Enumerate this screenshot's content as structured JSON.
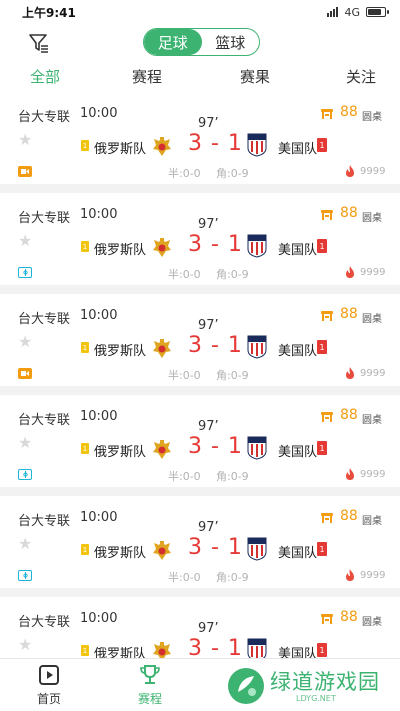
{
  "status_bar": {
    "time": "上午9:41",
    "network": "4G"
  },
  "sport_toggle": {
    "options": [
      "足球",
      "篮球"
    ],
    "selected": "足球"
  },
  "tabs": [
    "全部",
    "赛程",
    "赛果",
    "关注"
  ],
  "active_tab": "全部",
  "matches": [
    {
      "league": "台大专联",
      "time": "10:00",
      "minute": "97’",
      "home": "俄罗斯队",
      "home_yellow": "1",
      "score": "3 - 1",
      "away": "美国队",
      "away_red": "1",
      "half": "半:0-0",
      "corners": "角:0-9",
      "odds": "88",
      "table_label": "圆桌",
      "heat": "9999",
      "stream": "video"
    },
    {
      "league": "台大专联",
      "time": "10:00",
      "minute": "97’",
      "home": "俄罗斯队",
      "home_yellow": "1",
      "score": "3 - 1",
      "away": "美国队",
      "away_red": "1",
      "half": "半:0-0",
      "corners": "角:0-9",
      "odds": "88",
      "table_label": "圆桌",
      "heat": "9999",
      "stream": "animation"
    },
    {
      "league": "台大专联",
      "time": "10:00",
      "minute": "97’",
      "home": "俄罗斯队",
      "home_yellow": "1",
      "score": "3 - 1",
      "away": "美国队",
      "away_red": "1",
      "half": "半:0-0",
      "corners": "角:0-9",
      "odds": "88",
      "table_label": "圆桌",
      "heat": "9999",
      "stream": "video"
    },
    {
      "league": "台大专联",
      "time": "10:00",
      "minute": "97’",
      "home": "俄罗斯队",
      "home_yellow": "1",
      "score": "3 - 1",
      "away": "美国队",
      "away_red": "1",
      "half": "半:0-0",
      "corners": "角:0-9",
      "odds": "88",
      "table_label": "圆桌",
      "heat": "9999",
      "stream": "animation"
    },
    {
      "league": "台大专联",
      "time": "10:00",
      "minute": "97’",
      "home": "俄罗斯队",
      "home_yellow": "1",
      "score": "3 - 1",
      "away": "美国队",
      "away_red": "1",
      "half": "半:0-0",
      "corners": "角:0-9",
      "odds": "88",
      "table_label": "圆桌",
      "heat": "9999",
      "stream": "animation"
    },
    {
      "league": "台大专联",
      "time": "10:00",
      "minute": "97’",
      "home": "俄罗斯队",
      "home_yellow": "1",
      "score": "3 - 1",
      "away": "美国队",
      "away_red": "1",
      "half": "",
      "corners": "",
      "odds": "88",
      "table_label": "圆桌",
      "heat": "",
      "stream": ""
    }
  ],
  "bottom_nav": [
    {
      "label": "首页",
      "icon": "play-icon"
    },
    {
      "label": "赛程",
      "icon": "trophy-icon"
    }
  ],
  "active_nav": "赛程",
  "watermark": {
    "text": "绿道游戏园",
    "url": "LDYG.NET"
  },
  "colors": {
    "accent": "#3cb371",
    "score": "#e53935",
    "odds": "#f39c12",
    "anim_stream": "#1fb5d8",
    "yellow_card": "#f1c40f"
  }
}
